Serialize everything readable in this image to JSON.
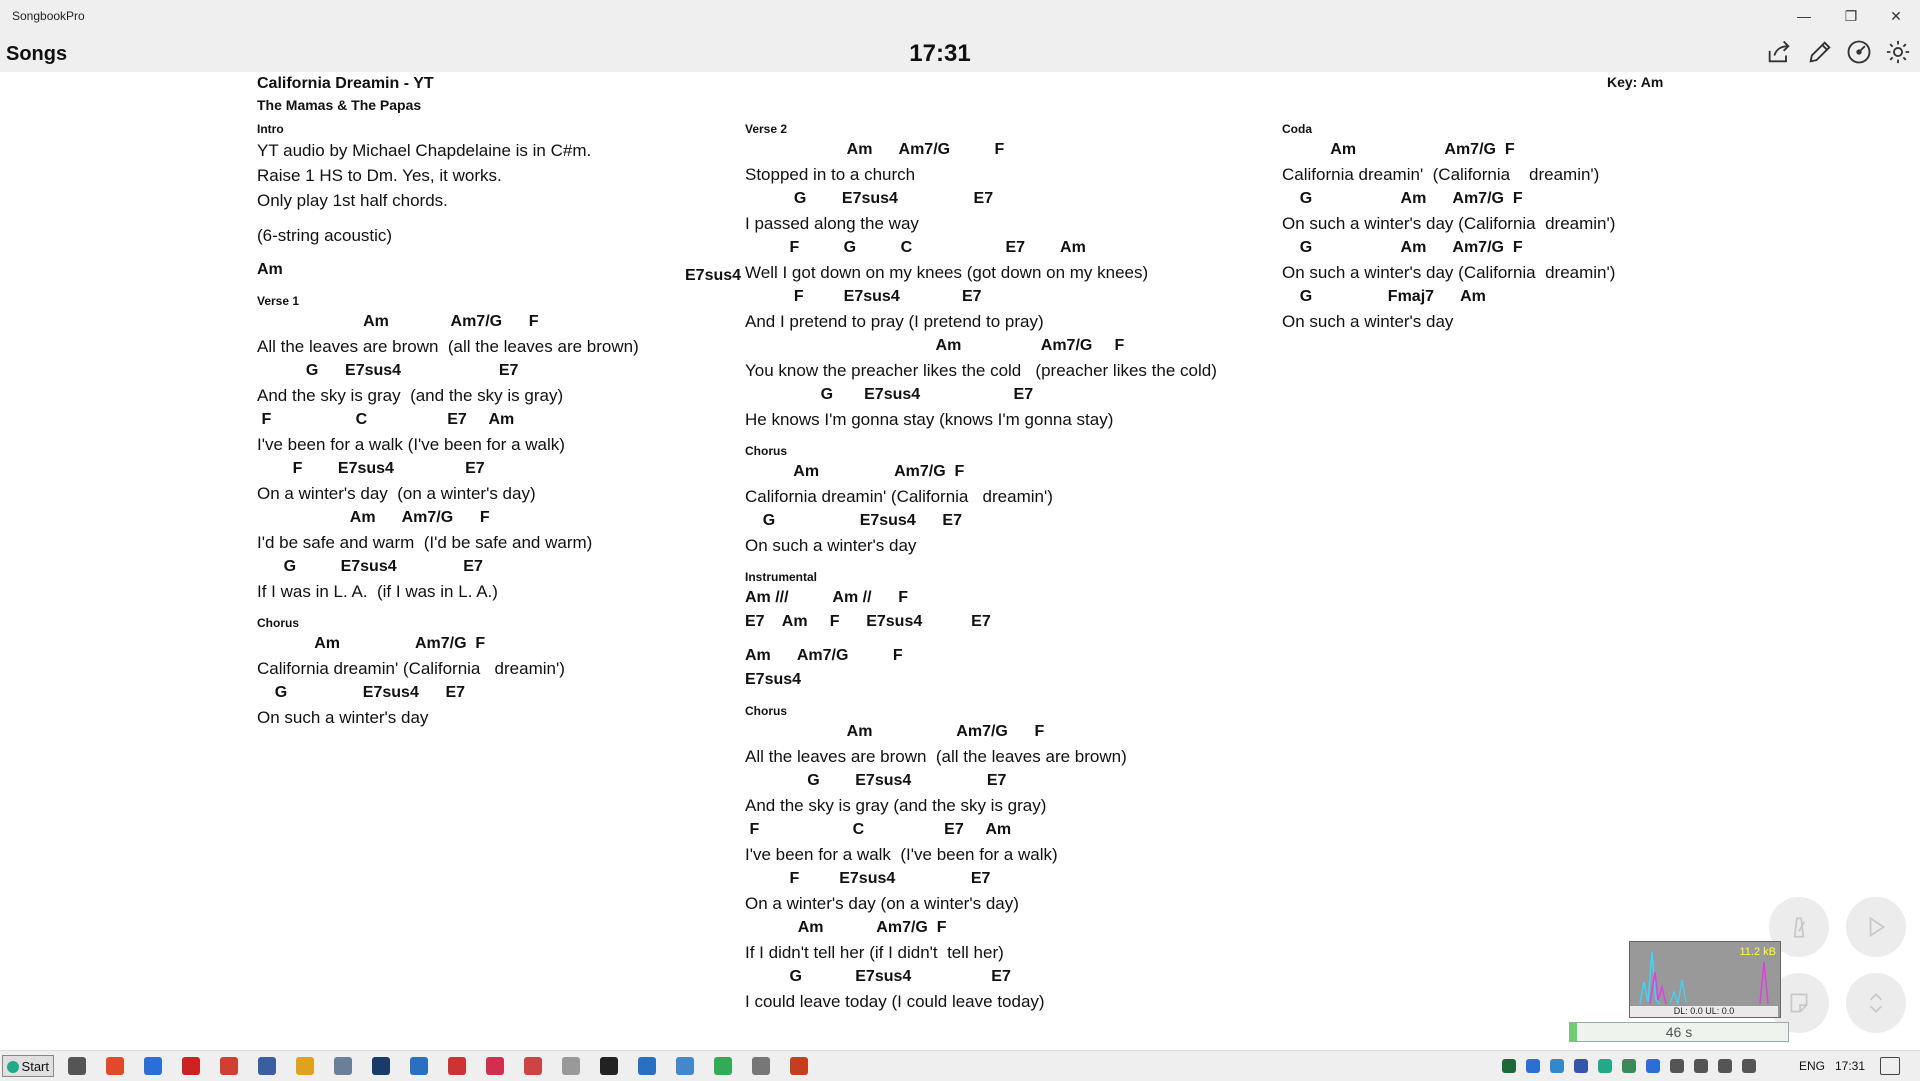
{
  "app": {
    "name": "SongbookPro",
    "nav_title": "Songs",
    "clock": "17:31"
  },
  "song": {
    "title": "California Dreamin - YT",
    "artist": "The Mamas & The Papas",
    "key": "Key: Am"
  },
  "col1": [
    {
      "section": "Intro"
    },
    {
      "comment": "YT audio by Michael Chapdelaine is in C#m."
    },
    {
      "comment": "Raise 1 HS to Dm. Yes, it works."
    },
    {
      "comment": "Only play 1st half chords."
    },
    {
      "gap": true
    },
    {
      "comment": "(6-string acoustic)"
    },
    {
      "gap": true
    },
    {
      "chord": "Am"
    },
    {
      "section": "Verse 1"
    },
    {
      "chord": "                        Am              Am7/G      F"
    },
    {
      "lyric": "All the leaves are brown  (all the leaves are brown)"
    },
    {
      "chord": "           G      E7sus4                      E7"
    },
    {
      "lyric": "And the sky is gray  (and the sky is gray)"
    },
    {
      "chord": " F                   C                  E7     Am"
    },
    {
      "lyric": "I've been for a walk (I've been for a walk)"
    },
    {
      "chord": "        F        E7sus4                E7"
    },
    {
      "lyric": "On a winter's day  (on a winter's day)"
    },
    {
      "chord": "                     Am      Am7/G      F"
    },
    {
      "lyric": "I'd be safe and warm  (I'd be safe and warm)"
    },
    {
      "chord": "      G          E7sus4               E7"
    },
    {
      "lyric": "If I was in L. A.  (if I was in L. A.)"
    },
    {
      "section": "Chorus"
    },
    {
      "chord": "             Am                 Am7/G  F"
    },
    {
      "lyric": "California dreamin' (California   dreamin')"
    },
    {
      "chord": "    G                 E7sus4      E7"
    },
    {
      "lyric": "On such a winter's day"
    }
  ],
  "col1_right_chord": "E7sus4",
  "col2": [
    {
      "section": "Verse 2"
    },
    {
      "chord": "                       Am      Am7/G          F"
    },
    {
      "lyric": "Stopped in to a church"
    },
    {
      "chord": "           G        E7sus4                 E7"
    },
    {
      "lyric": "I passed along the way"
    },
    {
      "chord": "          F          G          C                     E7        Am"
    },
    {
      "lyric": "Well I got down on my knees (got down on my knees)"
    },
    {
      "chord": "           F         E7sus4              E7"
    },
    {
      "lyric": "And I pretend to pray (I pretend to pray)"
    },
    {
      "chord": "                                           Am                  Am7/G     F"
    },
    {
      "lyric": "You know the preacher likes the cold   (preacher likes the cold)"
    },
    {
      "chord": "                 G       E7sus4                     E7"
    },
    {
      "lyric": "He knows I'm gonna stay (knows I'm gonna stay)"
    },
    {
      "section": "Chorus"
    },
    {
      "chord": "           Am                 Am7/G  F"
    },
    {
      "lyric": "California dreamin' (California   dreamin')"
    },
    {
      "chord": "    G                   E7sus4      E7"
    },
    {
      "lyric": "On such a winter's day"
    },
    {
      "section": "Instrumental"
    },
    {
      "chord": "Am ///          Am //      F"
    },
    {
      "chord": "E7    Am     F      E7sus4           E7"
    },
    {
      "gap": true
    },
    {
      "chord": "Am      Am7/G          F"
    },
    {
      "chord": "E7sus4"
    },
    {
      "section": "Chorus"
    },
    {
      "chord": "                       Am                   Am7/G      F"
    },
    {
      "lyric": "All the leaves are brown  (all the leaves are brown)"
    },
    {
      "chord": "              G        E7sus4                 E7"
    },
    {
      "lyric": "And the sky is gray (and the sky is gray)"
    },
    {
      "chord": " F                     C                  E7     Am"
    },
    {
      "lyric": "I've been for a walk  (I've been for a walk)"
    },
    {
      "chord": "          F         E7sus4                 E7"
    },
    {
      "lyric": "On a winter's day (on a winter's day)"
    },
    {
      "chord": "            Am            Am7/G  F"
    },
    {
      "lyric": "If I didn't tell her (if I didn't  tell her)"
    },
    {
      "chord": "          G            E7sus4                  E7"
    },
    {
      "lyric": "I could leave today (I could leave today)"
    }
  ],
  "col3": [
    {
      "section": "Coda"
    },
    {
      "chord": "           Am                    Am7/G  F"
    },
    {
      "lyric": "California dreamin'  (California    dreamin')"
    },
    {
      "chord": "    G                    Am      Am7/G  F"
    },
    {
      "lyric": "On such a winter's day (California  dreamin')"
    },
    {
      "chord": "    G                    Am      Am7/G  F"
    },
    {
      "lyric": "On such a winter's day (California  dreamin')"
    },
    {
      "chord": "    G                 Fmaj7      Am"
    },
    {
      "lyric": "On such a winter's day"
    }
  ],
  "widgets": {
    "net_speed": "11.2 kB",
    "net_dlul": "DL: 0.0 UL: 0.0",
    "timer": "46 s",
    "timer_progress": 0.03
  },
  "taskbar": {
    "start": "Start",
    "lang": "ENG",
    "time": "17:31"
  },
  "colors": {
    "accent": "#6dcf6d",
    "titlebar": "#efefef"
  }
}
